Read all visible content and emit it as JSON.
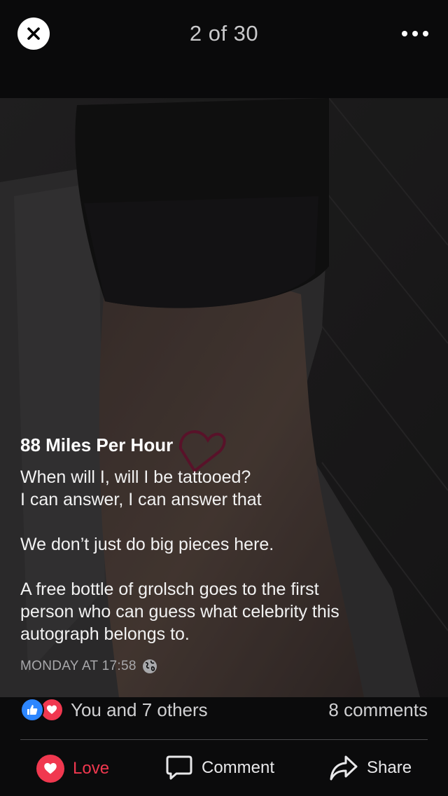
{
  "header": {
    "counter": "2 of 30",
    "close_icon": "close-icon",
    "more_icon": "more-dots-icon"
  },
  "post": {
    "title": "88 Miles Per Hour",
    "lines": [
      "When will I, will I be tattooed?",
      "I can answer, I can answer that",
      "We don’t just do big pieces here.",
      "A free bottle of grolsch goes to the first",
      "person who can guess what celebrity this",
      "autograph belongs to."
    ],
    "timestamp": "MONDAY AT 17:58",
    "privacy_icon": "globe-icon"
  },
  "reactions": {
    "summary": "You and 7 others",
    "comments": "8 comments",
    "like_color": "#2d86ff",
    "love_color": "#f0384f"
  },
  "actions": {
    "love_label": "Love",
    "comment_label": "Comment",
    "share_label": "Share"
  }
}
